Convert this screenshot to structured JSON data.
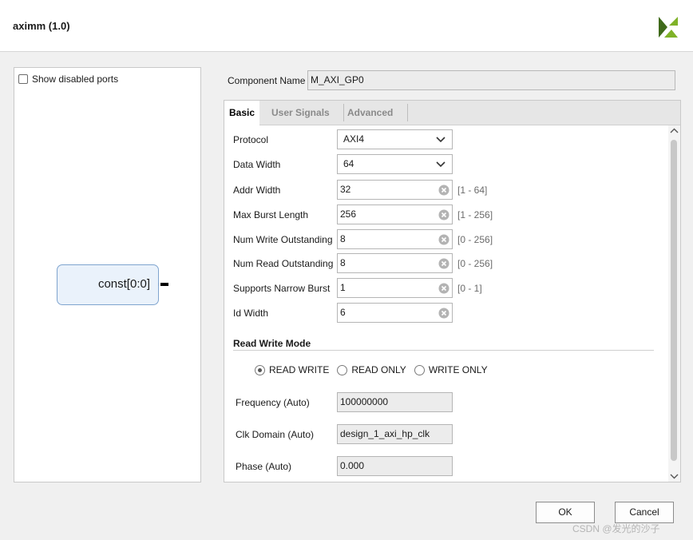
{
  "window": {
    "title": "aximm (1.0)"
  },
  "left_panel": {
    "show_disabled_label": "Show disabled ports",
    "show_disabled_checked": false,
    "block_port_label": "const[0:0]"
  },
  "component": {
    "label": "Component Name",
    "value": "M_AXI_GP0"
  },
  "tabs": [
    {
      "label": "Basic",
      "active": true
    },
    {
      "label": "User Signals",
      "active": false
    },
    {
      "label": "Advanced",
      "active": false
    }
  ],
  "params": {
    "protocol": {
      "label": "Protocol",
      "value": "AXI4"
    },
    "data_width": {
      "label": "Data Width",
      "value": "64"
    },
    "addr_width": {
      "label": "Addr Width",
      "value": "32",
      "range": "[1 - 64]"
    },
    "max_burst": {
      "label": "Max Burst Length",
      "value": "256",
      "range": "[1 - 256]"
    },
    "num_write": {
      "label": "Num Write Outstanding",
      "value": "8",
      "range": "[0 - 256]"
    },
    "num_read": {
      "label": "Num Read Outstanding",
      "value": "8",
      "range": "[0 - 256]"
    },
    "narrow_burst": {
      "label": "Supports Narrow Burst",
      "value": "1",
      "range": "[0 - 1]"
    },
    "id_width": {
      "label": "Id Width",
      "value": "6"
    }
  },
  "rw_mode": {
    "title": "Read Write Mode",
    "options": [
      "READ WRITE",
      "READ ONLY",
      "WRITE ONLY"
    ],
    "selected": "READ WRITE"
  },
  "auto": {
    "frequency": {
      "label": "Frequency (Auto)",
      "value": "100000000"
    },
    "clk_domain": {
      "label": "Clk Domain (Auto)",
      "value": "design_1_axi_hp_clk"
    },
    "phase": {
      "label": "Phase (Auto)",
      "value": "0.000"
    }
  },
  "buttons": {
    "ok": "OK",
    "cancel": "Cancel"
  },
  "watermark": "CSDN @发光的沙子",
  "colors": {
    "logo_green": "#7fb228",
    "logo_dark": "#3f6a1a",
    "block_fill": "#eaf2fb",
    "block_border": "#7fa4cf"
  }
}
